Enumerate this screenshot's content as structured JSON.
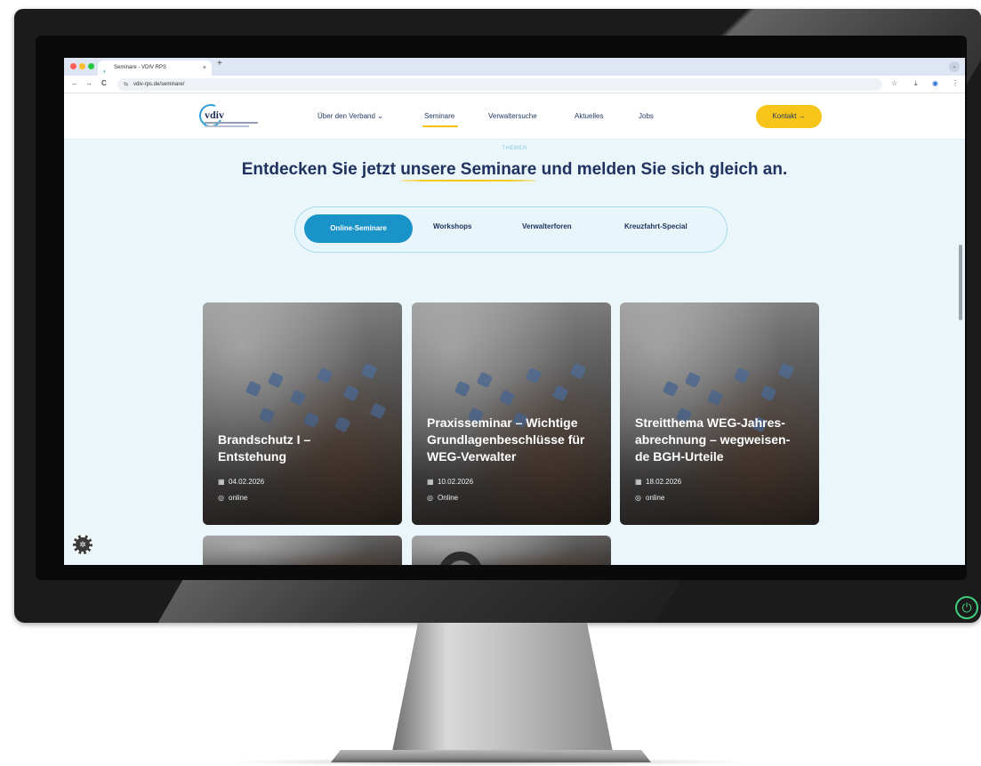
{
  "browser": {
    "tab_title": "Seminare - VDIV RPS",
    "tab_favicon": "vdiv-favicon-icon",
    "tab_close": "×",
    "new_tab": "+",
    "url": "vdiv-rps.de/seminare/",
    "back": "←",
    "forward": "→",
    "reload": "C",
    "site_info": "⇆",
    "bookmark": "☆",
    "download": "⤓",
    "profile": "◉",
    "menu": "⋮",
    "tab_menu": "⌄"
  },
  "header": {
    "logo_text": "vdiv",
    "nav": [
      {
        "label": "Über den Verband ⌄"
      },
      {
        "label": "Seminare"
      },
      {
        "label": "Verwaltersuche"
      },
      {
        "label": "Aktuelles"
      },
      {
        "label": "Jobs"
      }
    ],
    "contact_label": "Kontakt →"
  },
  "hero": {
    "eyebrow": "THEMEN",
    "headline_pre": "Entdecken Sie jetzt ",
    "headline_highlight": "unsere Seminare",
    "headline_post": " und melden Sie sich gleich an."
  },
  "filter_tabs": [
    {
      "label": "Online-Seminare",
      "active": true
    },
    {
      "label": "Workshops",
      "active": false
    },
    {
      "label": "Verwalterforen",
      "active": false
    },
    {
      "label": "Kreuzfahrt-Special",
      "active": false
    }
  ],
  "cards": [
    {
      "title_line1": "Brandschutz I –",
      "title_line2": "Entstehung",
      "title_line3": "",
      "date": "04.02.2026",
      "location": "online"
    },
    {
      "title_line1": "Praxisseminar – Wichtige",
      "title_line2": "Grundlagenbeschlüsse für",
      "title_line3": "WEG-Verwalter",
      "date": "10.02.2026",
      "location": "Online"
    },
    {
      "title_line1": "Streitthema WEG-Jahres-",
      "title_line2": "abrechnung – wegweisen-",
      "title_line3": "de BGH-Urteile",
      "date": "18.02.2026",
      "location": "online"
    }
  ],
  "colors": {
    "accent_blue": "#1a93c9",
    "accent_yellow": "#f7c51a",
    "navy": "#1f3260",
    "page_bg": "#eaf6fa",
    "power_green": "#3fd07e"
  }
}
